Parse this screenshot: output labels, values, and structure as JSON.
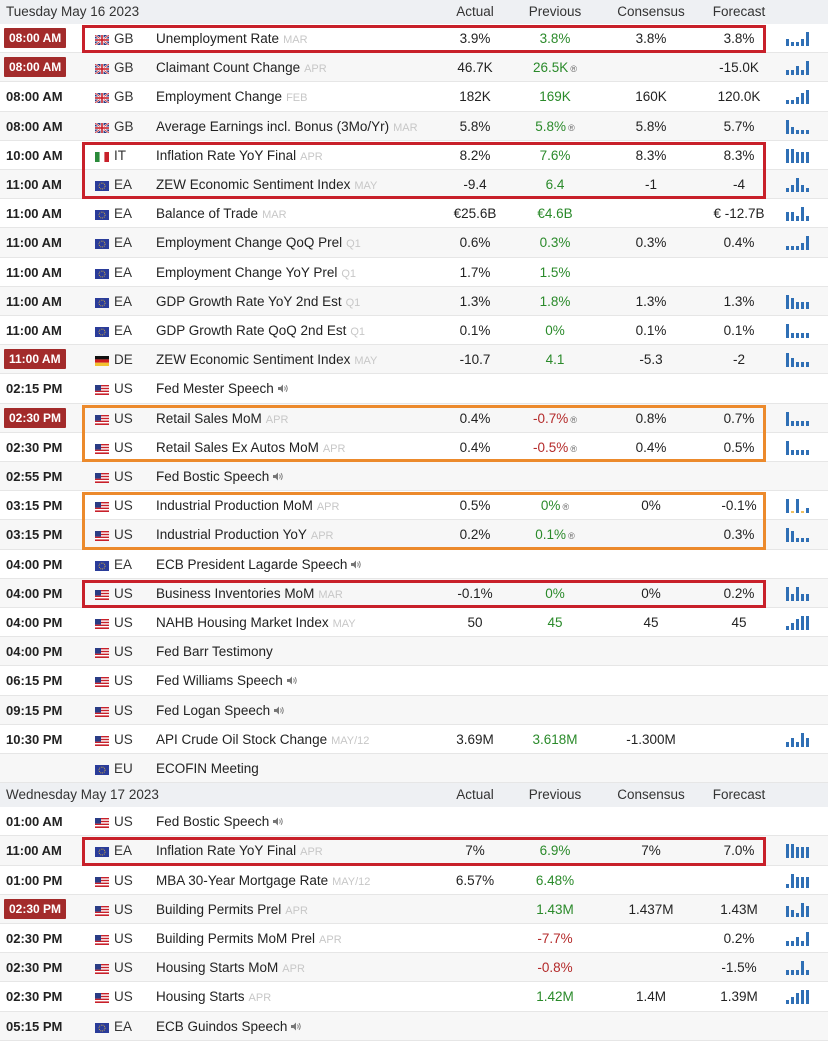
{
  "days": [
    {
      "date": "Tuesday May 16 2023",
      "columns": [
        "Actual",
        "Previous",
        "Consensus",
        "Forecast"
      ],
      "rows": [
        {
          "time": "08:00 AM",
          "badge": true,
          "flag": "GB",
          "country": "GB",
          "event": "Unemployment Rate",
          "ref": "MAR",
          "actual": "3.9%",
          "previous": "3.8%",
          "prev_color": "green",
          "consensus": "3.8%",
          "forecast": "3.8%",
          "spark": [
            2,
            1,
            1,
            2,
            4
          ]
        },
        {
          "time": "08:00 AM",
          "badge": true,
          "flag": "GB",
          "country": "GB",
          "event": "Claimant Count Change",
          "ref": "APR",
          "actual": "46.7K",
          "previous": "26.5K",
          "prev_color": "green",
          "revised": true,
          "consensus": "",
          "forecast": "-15.0K",
          "spark": [
            1,
            1,
            2,
            1,
            3
          ]
        },
        {
          "time": "08:00 AM",
          "badge": false,
          "flag": "GB",
          "country": "GB",
          "event": "Employment Change",
          "ref": "FEB",
          "actual": "182K",
          "previous": "169K",
          "prev_color": "green",
          "consensus": "160K",
          "forecast": "120.0K",
          "spark": [
            1,
            1,
            2,
            3,
            4
          ]
        },
        {
          "time": "08:00 AM",
          "badge": false,
          "flag": "GB",
          "country": "GB",
          "event": "Average Earnings incl. Bonus (3Mo/Yr)",
          "ref": "MAR",
          "actual": "5.8%",
          "previous": "5.8%",
          "prev_color": "green",
          "revised": true,
          "consensus": "5.8%",
          "forecast": "5.7%",
          "spark": [
            4,
            2,
            1,
            1,
            1
          ]
        },
        {
          "time": "10:00 AM",
          "badge": false,
          "flag": "IT",
          "country": "IT",
          "event": "Inflation Rate YoY Final",
          "ref": "APR",
          "actual": "8.2%",
          "previous": "7.6%",
          "prev_color": "green",
          "consensus": "8.3%",
          "forecast": "8.3%",
          "spark": [
            4,
            4,
            3,
            3,
            3
          ]
        },
        {
          "time": "11:00 AM",
          "badge": false,
          "flag": "EA",
          "country": "EA",
          "event": "ZEW Economic Sentiment Index",
          "ref": "MAY",
          "actual": "-9.4",
          "previous": "6.4",
          "prev_color": "green",
          "consensus": "-1",
          "forecast": "-4",
          "spark": [
            1,
            2,
            4,
            2,
            1
          ]
        },
        {
          "time": "11:00 AM",
          "badge": false,
          "flag": "EA",
          "country": "EA",
          "event": "Balance of Trade",
          "ref": "MAR",
          "actual": "€25.6B",
          "previous": "€4.6B",
          "prev_color": "green",
          "consensus": "",
          "forecast": "€ -12.7B",
          "spark": [
            2,
            2,
            1,
            3,
            1
          ]
        },
        {
          "time": "11:00 AM",
          "badge": false,
          "flag": "EA",
          "country": "EA",
          "event": "Employment Change QoQ Prel",
          "ref": "Q1",
          "actual": "0.6%",
          "previous": "0.3%",
          "prev_color": "green",
          "consensus": "0.3%",
          "forecast": "0.4%",
          "spark": [
            1,
            1,
            1,
            2,
            4
          ]
        },
        {
          "time": "11:00 AM",
          "badge": false,
          "flag": "EA",
          "country": "EA",
          "event": "Employment Change YoY Prel",
          "ref": "Q1",
          "actual": "1.7%",
          "previous": "1.5%",
          "prev_color": "green",
          "consensus": "",
          "forecast": "",
          "spark": []
        },
        {
          "time": "11:00 AM",
          "badge": false,
          "flag": "EA",
          "country": "EA",
          "event": "GDP Growth Rate YoY 2nd Est",
          "ref": "Q1",
          "actual": "1.3%",
          "previous": "1.8%",
          "prev_color": "green",
          "consensus": "1.3%",
          "forecast": "1.3%",
          "spark": [
            4,
            3,
            2,
            2,
            2
          ]
        },
        {
          "time": "11:00 AM",
          "badge": false,
          "flag": "EA",
          "country": "EA",
          "event": "GDP Growth Rate QoQ 2nd Est",
          "ref": "Q1",
          "actual": "0.1%",
          "previous": "0%",
          "prev_color": "green",
          "consensus": "0.1%",
          "forecast": "0.1%",
          "spark": [
            3,
            1,
            1,
            1,
            1
          ]
        },
        {
          "time": "11:00 AM",
          "badge": true,
          "flag": "DE",
          "country": "DE",
          "event": "ZEW Economic Sentiment Index",
          "ref": "MAY",
          "actual": "-10.7",
          "previous": "4.1",
          "prev_color": "green",
          "consensus": "-5.3",
          "forecast": "-2",
          "spark": [
            3,
            2,
            1,
            1,
            1
          ]
        },
        {
          "time": "02:15 PM",
          "badge": false,
          "flag": "US",
          "country": "US",
          "event": "Fed Mester Speech",
          "ref": "",
          "speech": true,
          "actual": "",
          "previous": "",
          "prev_color": "green",
          "consensus": "",
          "forecast": "",
          "spark": []
        },
        {
          "time": "02:30 PM",
          "badge": true,
          "flag": "US",
          "country": "US",
          "event": "Retail Sales MoM",
          "ref": "APR",
          "actual": "0.4%",
          "previous": "-0.7%",
          "prev_color": "red",
          "revised": true,
          "consensus": "0.8%",
          "forecast": "0.7%",
          "spark": [
            3,
            1,
            1,
            1,
            1
          ]
        },
        {
          "time": "02:30 PM",
          "badge": false,
          "flag": "US",
          "country": "US",
          "event": "Retail Sales Ex Autos MoM",
          "ref": "APR",
          "actual": "0.4%",
          "previous": "-0.5%",
          "prev_color": "red",
          "revised": true,
          "consensus": "0.4%",
          "forecast": "0.5%",
          "spark": [
            3,
            1,
            1,
            1,
            1
          ]
        },
        {
          "time": "02:55 PM",
          "badge": false,
          "flag": "US",
          "country": "US",
          "event": "Fed Bostic Speech",
          "ref": "",
          "speech": true,
          "actual": "",
          "previous": "",
          "prev_color": "green",
          "consensus": "",
          "forecast": "",
          "spark": []
        },
        {
          "time": "03:15 PM",
          "badge": false,
          "flag": "US",
          "country": "US",
          "event": "Industrial Production MoM",
          "ref": "APR",
          "actual": "0.5%",
          "previous": "0%",
          "prev_color": "green",
          "revised": true,
          "consensus": "0%",
          "forecast": "-0.1%",
          "spark": [
            3,
            0,
            3,
            0,
            1
          ]
        },
        {
          "time": "03:15 PM",
          "badge": false,
          "flag": "US",
          "country": "US",
          "event": "Industrial Production YoY",
          "ref": "APR",
          "actual": "0.2%",
          "previous": "0.1%",
          "prev_color": "green",
          "revised": true,
          "consensus": "",
          "forecast": "0.3%",
          "spark": [
            4,
            3,
            1,
            1,
            1
          ]
        },
        {
          "time": "04:00 PM",
          "badge": false,
          "flag": "EA",
          "country": "EA",
          "event": "ECB President Lagarde Speech",
          "ref": "",
          "speech": true,
          "actual": "",
          "previous": "",
          "prev_color": "green",
          "consensus": "",
          "forecast": "",
          "spark": []
        },
        {
          "time": "04:00 PM",
          "badge": false,
          "flag": "US",
          "country": "US",
          "event": "Business Inventories MoM",
          "ref": "MAR",
          "actual": "-0.1%",
          "previous": "0%",
          "prev_color": "green",
          "consensus": "0%",
          "forecast": "0.2%",
          "spark": [
            2,
            1,
            2,
            1,
            1
          ]
        },
        {
          "time": "04:00 PM",
          "badge": false,
          "flag": "US",
          "country": "US",
          "event": "NAHB Housing Market Index",
          "ref": "MAY",
          "actual": "50",
          "previous": "45",
          "prev_color": "green",
          "consensus": "45",
          "forecast": "45",
          "spark": [
            1,
            2,
            3,
            4,
            4
          ]
        },
        {
          "time": "04:00 PM",
          "badge": false,
          "flag": "US",
          "country": "US",
          "event": "Fed Barr Testimony",
          "ref": "",
          "actual": "",
          "previous": "",
          "prev_color": "green",
          "consensus": "",
          "forecast": "",
          "spark": []
        },
        {
          "time": "06:15 PM",
          "badge": false,
          "flag": "US",
          "country": "US",
          "event": "Fed Williams Speech",
          "ref": "",
          "speech": true,
          "actual": "",
          "previous": "",
          "prev_color": "green",
          "consensus": "",
          "forecast": "",
          "spark": []
        },
        {
          "time": "09:15 PM",
          "badge": false,
          "flag": "US",
          "country": "US",
          "event": "Fed Logan Speech",
          "ref": "",
          "speech": true,
          "actual": "",
          "previous": "",
          "prev_color": "green",
          "consensus": "",
          "forecast": "",
          "spark": []
        },
        {
          "time": "10:30 PM",
          "badge": false,
          "flag": "US",
          "country": "US",
          "event": "API Crude Oil Stock Change",
          "ref": "MAY/12",
          "actual": "3.69M",
          "previous": "3.618M",
          "prev_color": "green",
          "consensus": "-1.300M",
          "forecast": "",
          "spark": [
            1,
            2,
            1,
            3,
            2
          ]
        },
        {
          "time": "",
          "badge": false,
          "flag": "EA",
          "country": "EU",
          "event": "ECOFIN Meeting",
          "ref": "",
          "actual": "",
          "previous": "",
          "prev_color": "green",
          "consensus": "",
          "forecast": "",
          "spark": []
        }
      ]
    },
    {
      "date": "Wednesday May 17 2023",
      "columns": [
        "Actual",
        "Previous",
        "Consensus",
        "Forecast"
      ],
      "rows": [
        {
          "time": "01:00 AM",
          "badge": false,
          "flag": "US",
          "country": "US",
          "event": "Fed Bostic Speech",
          "ref": "",
          "speech": true,
          "actual": "",
          "previous": "",
          "prev_color": "green",
          "consensus": "",
          "forecast": "",
          "spark": []
        },
        {
          "time": "11:00 AM",
          "badge": false,
          "flag": "EA",
          "country": "EA",
          "event": "Inflation Rate YoY Final",
          "ref": "APR",
          "actual": "7%",
          "previous": "6.9%",
          "prev_color": "green",
          "consensus": "7%",
          "forecast": "7.0%",
          "spark": [
            4,
            4,
            3,
            3,
            3
          ]
        },
        {
          "time": "01:00 PM",
          "badge": false,
          "flag": "US",
          "country": "US",
          "event": "MBA 30-Year Mortgage Rate",
          "ref": "MAY/12",
          "actual": "6.57%",
          "previous": "6.48%",
          "prev_color": "green",
          "consensus": "",
          "forecast": "",
          "spark": [
            1,
            4,
            3,
            3,
            3
          ]
        },
        {
          "time": "02:30 PM",
          "badge": true,
          "flag": "US",
          "country": "US",
          "event": "Building Permits Prel",
          "ref": "APR",
          "actual": "",
          "previous": "1.43M",
          "prev_color": "green",
          "consensus": "1.437M",
          "forecast": "1.43M",
          "spark": [
            3,
            2,
            1,
            4,
            3
          ]
        },
        {
          "time": "02:30 PM",
          "badge": false,
          "flag": "US",
          "country": "US",
          "event": "Building Permits MoM Prel",
          "ref": "APR",
          "actual": "",
          "previous": "-7.7%",
          "prev_color": "red",
          "consensus": "",
          "forecast": "0.2%",
          "spark": [
            1,
            1,
            2,
            1,
            3
          ]
        },
        {
          "time": "02:30 PM",
          "badge": false,
          "flag": "US",
          "country": "US",
          "event": "Housing Starts MoM",
          "ref": "APR",
          "actual": "",
          "previous": "-0.8%",
          "prev_color": "red",
          "consensus": "",
          "forecast": "-1.5%",
          "spark": [
            1,
            1,
            1,
            3,
            1
          ]
        },
        {
          "time": "02:30 PM",
          "badge": false,
          "flag": "US",
          "country": "US",
          "event": "Housing Starts",
          "ref": "APR",
          "actual": "",
          "previous": "1.42M",
          "prev_color": "green",
          "consensus": "1.4M",
          "forecast": "1.39M",
          "spark": [
            1,
            2,
            3,
            4,
            4
          ]
        },
        {
          "time": "05:15 PM",
          "badge": false,
          "flag": "EA",
          "country": "EA",
          "event": "ECB Guindos Speech",
          "ref": "",
          "speech": true,
          "actual": "",
          "previous": "",
          "prev_color": "green",
          "consensus": "",
          "forecast": "",
          "spark": []
        }
      ]
    }
  ],
  "highlights": [
    {
      "day": 0,
      "from": 0,
      "to": 0,
      "color": "red"
    },
    {
      "day": 0,
      "from": 4,
      "to": 5,
      "color": "red"
    },
    {
      "day": 0,
      "from": 13,
      "to": 14,
      "color": "orange"
    },
    {
      "day": 0,
      "from": 16,
      "to": 17,
      "color": "orange"
    },
    {
      "day": 0,
      "from": 19,
      "to": 19,
      "color": "red"
    },
    {
      "day": 1,
      "from": 1,
      "to": 1,
      "color": "red"
    }
  ],
  "colors": {
    "badge": "#a32b2b",
    "green": "#2a8a2a",
    "red": "#b42a2a",
    "spark": "#2f6fb5",
    "highlight_red": "#c8202a",
    "highlight_orange": "#ec8a2c"
  }
}
